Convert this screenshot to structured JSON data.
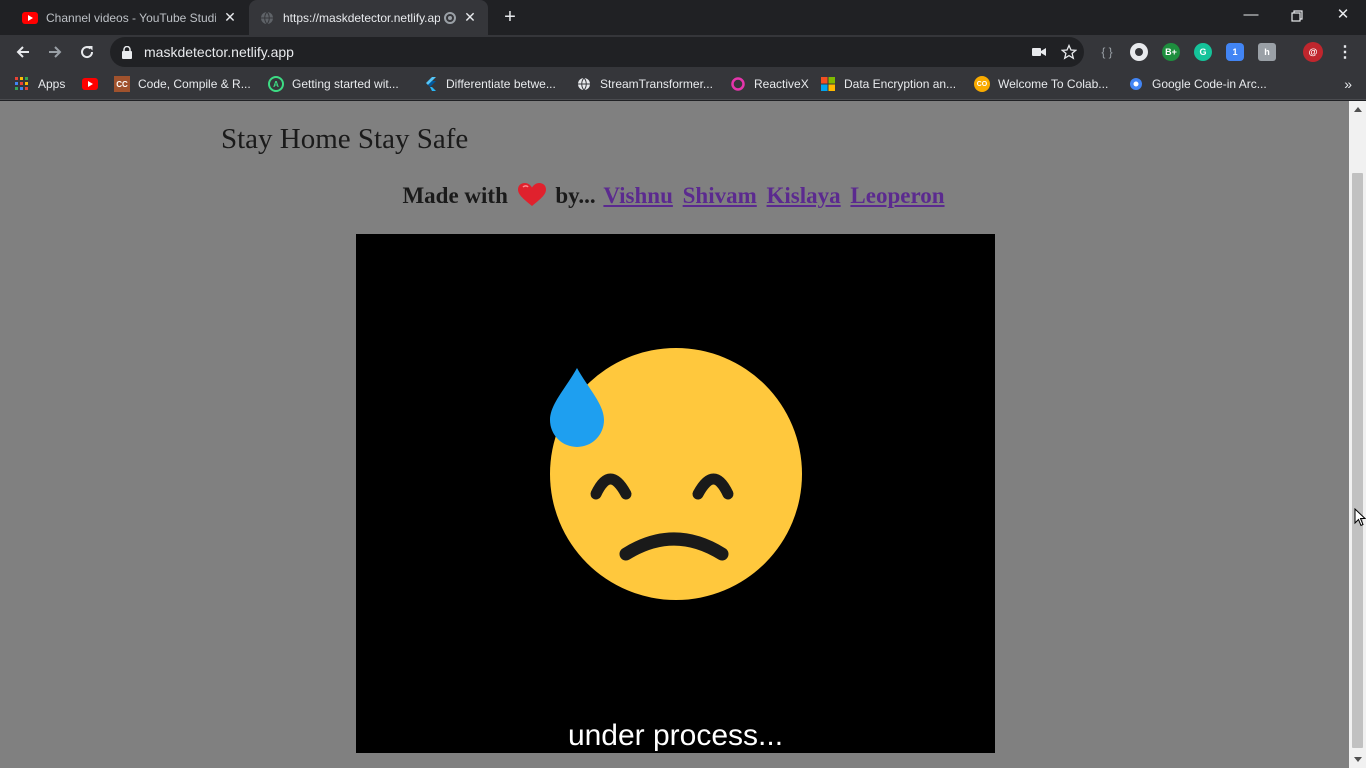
{
  "tabs": [
    {
      "title": "Channel videos - YouTube Studio",
      "icon": "youtube-icon"
    },
    {
      "title": "https://maskdetector.netlify.app",
      "icon": "globe-icon"
    }
  ],
  "address_bar": {
    "url": "maskdetector.netlify.app"
  },
  "bookmarks": [
    {
      "label": "Apps",
      "icon": "apps-grid-icon"
    },
    {
      "label": "",
      "icon": "youtube-icon"
    },
    {
      "label": "Code, Compile & R...",
      "icon": "code-compile-icon"
    },
    {
      "label": "Getting started wit...",
      "icon": "android-studio-icon"
    },
    {
      "label": "Differentiate betwe...",
      "icon": "flutter-icon"
    },
    {
      "label": "StreamTransformer...",
      "icon": "globe-icon"
    },
    {
      "label": "ReactiveX",
      "icon": "reactivex-icon"
    },
    {
      "label": "Data Encryption an...",
      "icon": "microsoft-icon"
    },
    {
      "label": "Welcome To Colab...",
      "icon": "colab-icon"
    },
    {
      "label": "Google Code-in Arc...",
      "icon": "google-code-in-icon"
    }
  ],
  "page": {
    "heading": "Stay Home Stay Safe",
    "made_with": "Made with",
    "by": "by...",
    "authors": [
      "Vishnu",
      "Shivam",
      "Kislaya",
      "Leoperon"
    ],
    "video_caption": "under process..."
  },
  "colors": {
    "page_background": "#808080",
    "link": "#5b2a8f",
    "emoji_face": "#ffc83d",
    "sweat_drop": "#1e9ff0"
  }
}
